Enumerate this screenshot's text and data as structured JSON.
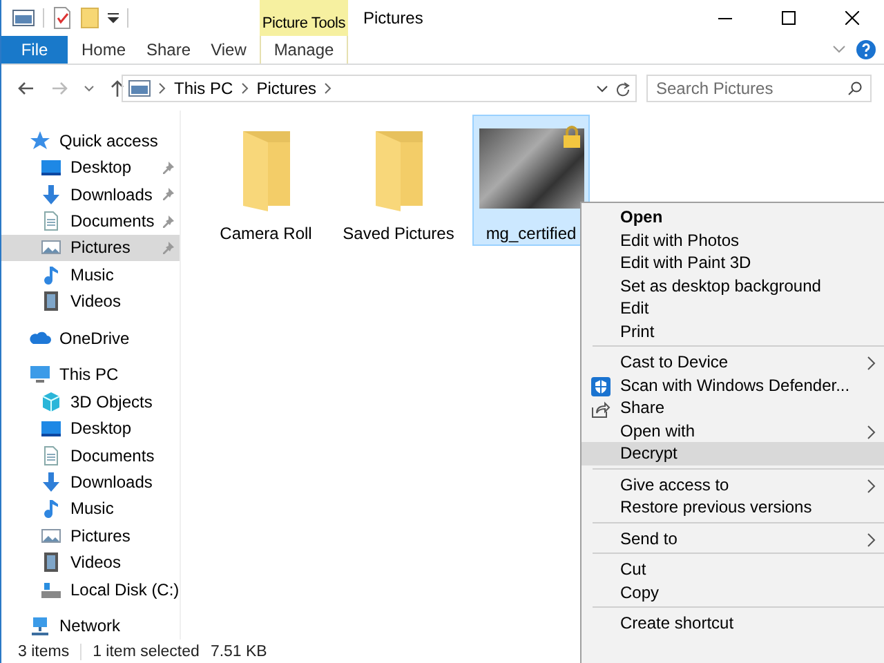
{
  "window": {
    "title": "Pictures",
    "contextual_header": "Picture Tools"
  },
  "ribbon": {
    "tabs": [
      {
        "label": "File",
        "kind": "file"
      },
      {
        "label": "Home",
        "kind": "tab"
      },
      {
        "label": "Share",
        "kind": "tab"
      },
      {
        "label": "View",
        "kind": "tab"
      },
      {
        "label": "Manage",
        "kind": "contextual"
      }
    ]
  },
  "address": {
    "path": [
      "This PC",
      "Pictures"
    ],
    "search": {
      "placeholder": "Search Pictures"
    }
  },
  "nav": [
    {
      "label": "Quick access",
      "selected": false,
      "children": [
        {
          "label": "Desktop",
          "pinned": true,
          "selected": false
        },
        {
          "label": "Downloads",
          "pinned": true,
          "selected": false
        },
        {
          "label": "Documents",
          "pinned": true,
          "selected": false
        },
        {
          "label": "Pictures",
          "pinned": true,
          "selected": true
        },
        {
          "label": "Music",
          "pinned": false,
          "selected": false
        },
        {
          "label": "Videos",
          "pinned": false,
          "selected": false
        }
      ]
    },
    {
      "label": "OneDrive",
      "selected": false
    },
    {
      "label": "This PC",
      "selected": false,
      "children": [
        {
          "label": "3D Objects",
          "selected": false
        },
        {
          "label": "Desktop",
          "selected": false
        },
        {
          "label": "Documents",
          "selected": false
        },
        {
          "label": "Downloads",
          "selected": false
        },
        {
          "label": "Music",
          "selected": false
        },
        {
          "label": "Pictures",
          "selected": false
        },
        {
          "label": "Videos",
          "selected": false
        },
        {
          "label": "Local Disk (C:)",
          "selected": false
        }
      ]
    },
    {
      "label": "Network",
      "selected": false
    }
  ],
  "files": [
    {
      "name": "Camera Roll",
      "kind": "folder",
      "selected": false
    },
    {
      "name": "Saved Pictures",
      "kind": "folder",
      "selected": false
    },
    {
      "name": "mg_certified",
      "kind": "image",
      "selected": true,
      "encrypted": true
    }
  ],
  "menu": {
    "items": [
      {
        "kind": "item",
        "label": "Open",
        "default": true,
        "selected": false
      },
      {
        "kind": "item",
        "label": "Edit with Photos",
        "selected": false
      },
      {
        "kind": "item",
        "label": "Edit with Paint 3D",
        "selected": false
      },
      {
        "kind": "item",
        "label": "Set as desktop background",
        "selected": false
      },
      {
        "kind": "item",
        "label": "Edit",
        "selected": false
      },
      {
        "kind": "item",
        "label": "Print",
        "selected": false
      },
      {
        "kind": "separator"
      },
      {
        "kind": "item",
        "label": "Cast to Device",
        "submenu": true,
        "selected": false
      },
      {
        "kind": "item",
        "label": "Scan with Windows Defender...",
        "selected": false
      },
      {
        "kind": "item",
        "label": "Share",
        "selected": false
      },
      {
        "kind": "item",
        "label": "Open with",
        "submenu": true,
        "selected": false
      },
      {
        "kind": "item",
        "label": "Decrypt",
        "selected": true
      },
      {
        "kind": "separator"
      },
      {
        "kind": "item",
        "label": "Give access to",
        "submenu": true,
        "selected": false
      },
      {
        "kind": "item",
        "label": "Restore previous versions",
        "selected": false
      },
      {
        "kind": "separator"
      },
      {
        "kind": "item",
        "label": "Send to",
        "submenu": true,
        "selected": false
      },
      {
        "kind": "separator"
      },
      {
        "kind": "item",
        "label": "Cut",
        "selected": false
      },
      {
        "kind": "item",
        "label": "Copy",
        "selected": false
      },
      {
        "kind": "separator"
      },
      {
        "kind": "item",
        "label": "Create shortcut",
        "selected": false
      }
    ]
  },
  "status_bar": {
    "count": "3 items",
    "selection": "1 item selected",
    "size": "7.51 KB"
  }
}
